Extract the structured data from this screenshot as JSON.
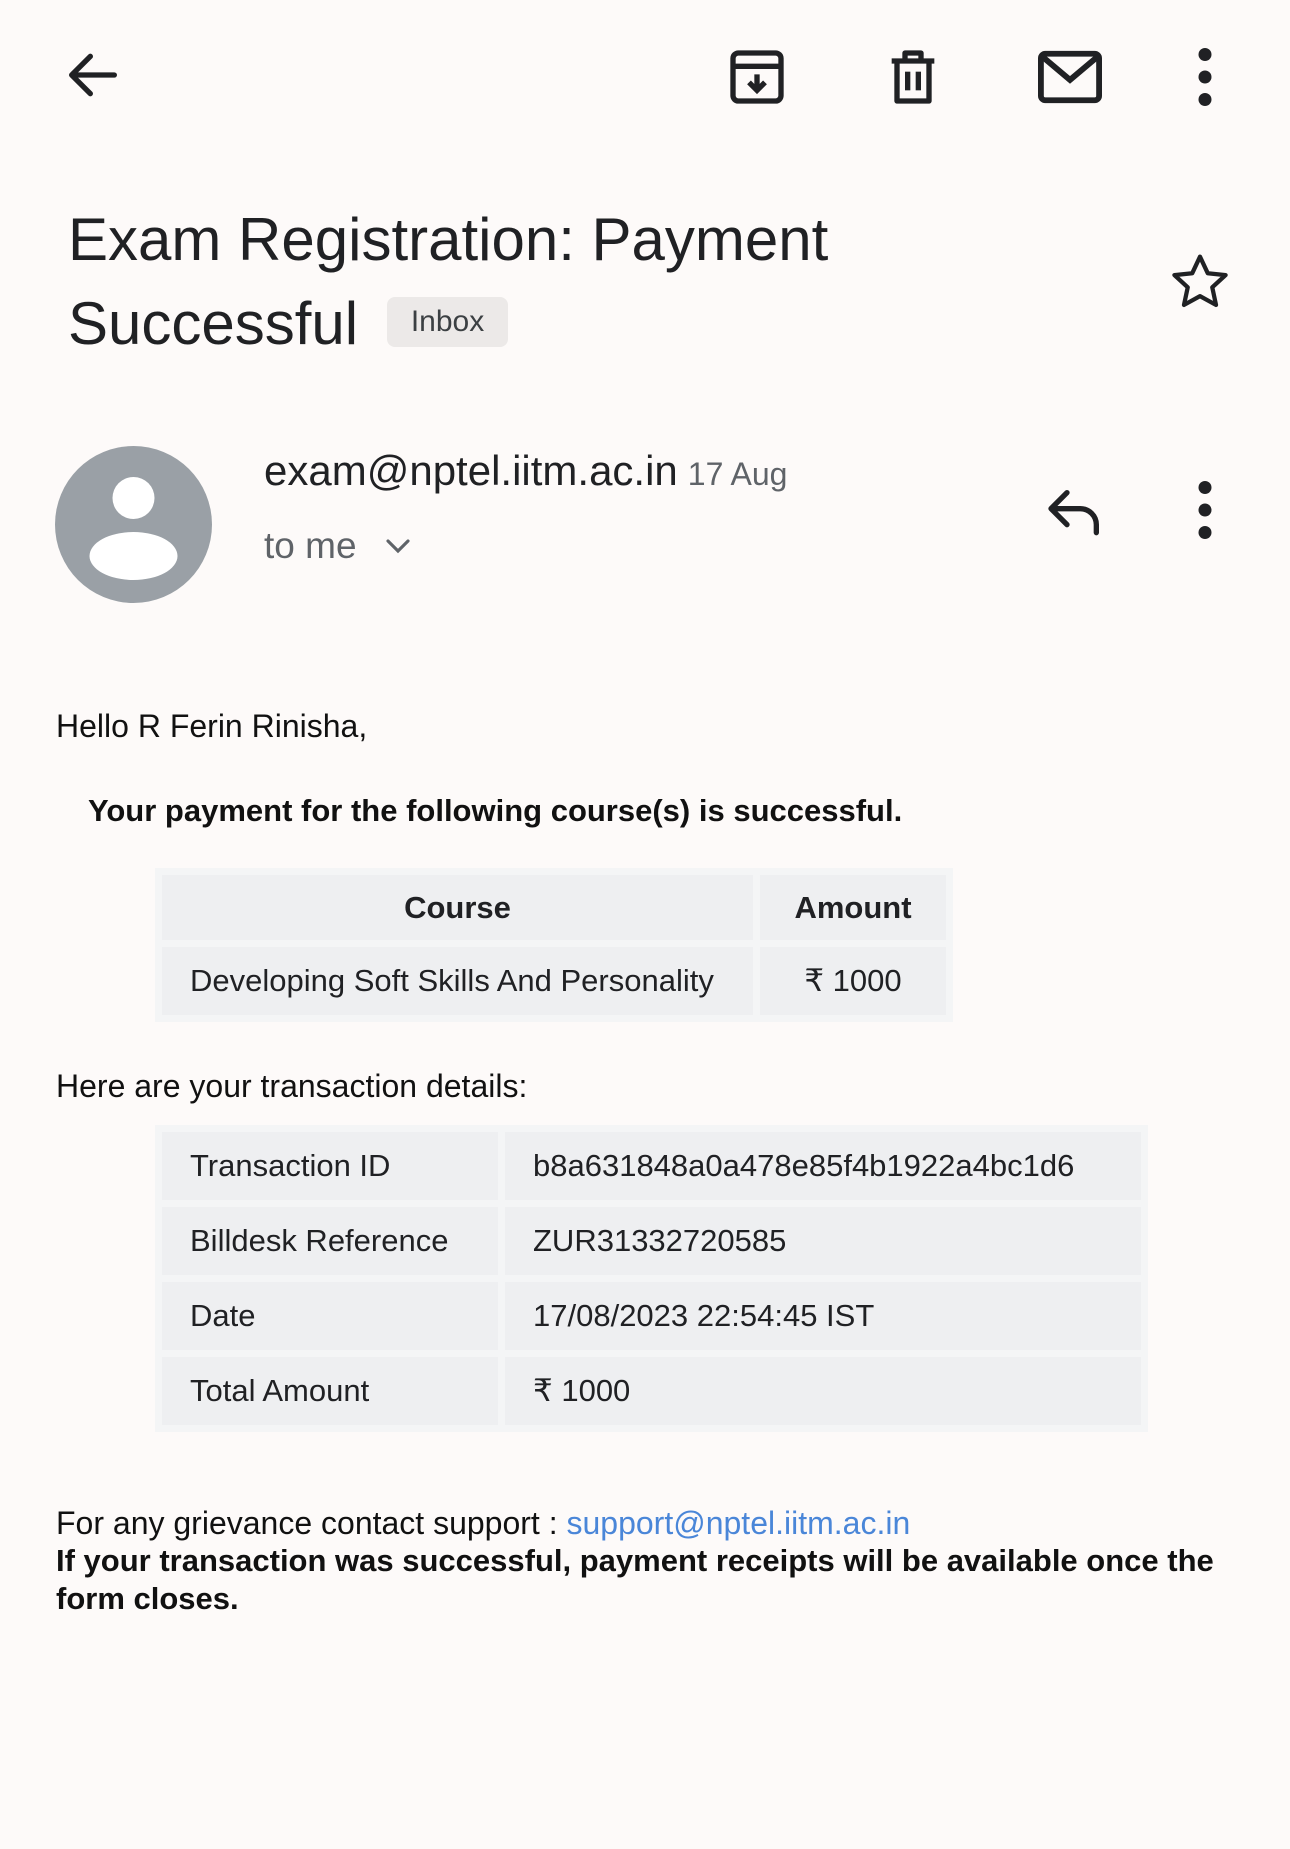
{
  "email": {
    "subject": "Exam Registration: Payment Successful",
    "label_badge": "Inbox",
    "sender": "exam@nptel.iitm.ac.in",
    "date": "17 Aug",
    "recipient": "to me"
  },
  "body": {
    "greeting": "Hello R Ferin Rinisha,",
    "payment_line": "Your payment for the following course(s) is successful.",
    "course_table": {
      "headers": [
        "Course",
        "Amount"
      ],
      "rows": [
        [
          "Developing Soft Skills And Personality",
          "₹ 1000"
        ]
      ]
    },
    "transaction_intro": "Here are your transaction details:",
    "transaction_table": [
      [
        "Transaction ID",
        "b8a631848a0a478e85f4b1922a4bc1d6"
      ],
      [
        "Billdesk Reference",
        "ZUR31332720585"
      ],
      [
        "Date",
        "17/08/2023 22:54:45 IST"
      ],
      [
        "Total Amount",
        "₹ 1000"
      ]
    ],
    "support_label": "For any grievance contact support : ",
    "support_email": "support@nptel.iitm.ac.in",
    "notice": "If your transaction was successful, payment receipts will be available once the form closes."
  },
  "icons": {
    "back": "arrow-left",
    "archive": "archive-box",
    "delete": "trash",
    "mark_unread": "envelope",
    "more": "vertical-dots",
    "star": "star-outline",
    "reply": "reply-arrow",
    "avatar": "person-silhouette"
  },
  "colors": {
    "background": "#fdfaf9",
    "link": "#4a86d8",
    "avatar_bg": "#9aa0a6",
    "badge_bg": "#ece9e8"
  }
}
